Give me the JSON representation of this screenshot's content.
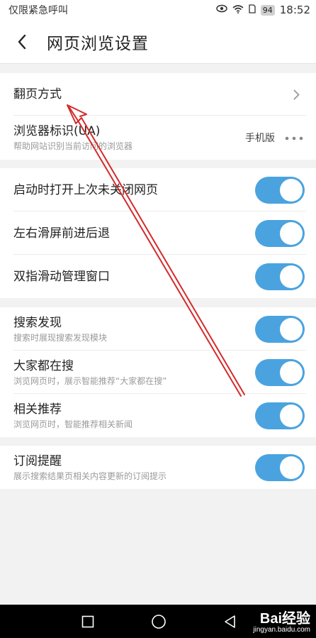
{
  "status_bar": {
    "carrier": "仅限紧急呼叫",
    "battery": "94",
    "time": "18:52"
  },
  "header": {
    "title": "网页浏览设置"
  },
  "group1": [
    {
      "title": "翻页方式",
      "subtitle": "",
      "control": "chevron"
    },
    {
      "title": "浏览器标识(UA)",
      "subtitle": "帮助网站识别当前访问的浏览器",
      "value": "手机版",
      "control": "more"
    }
  ],
  "group2": [
    {
      "title": "启动时打开上次未关闭网页",
      "on": true
    },
    {
      "title": "左右滑屏前进后退",
      "on": true
    },
    {
      "title": "双指滑动管理窗口",
      "on": true
    }
  ],
  "group3": [
    {
      "title": "搜索发现",
      "subtitle": "搜索时展现搜索发现模块",
      "on": true
    },
    {
      "title": "大家都在搜",
      "subtitle": "浏览网页时，展示智能推荐“大家都在搜”",
      "on": true
    },
    {
      "title": "相关推荐",
      "subtitle": "浏览网页时，智能推荐相关新闻",
      "on": true
    }
  ],
  "group4": [
    {
      "title": "订阅提醒",
      "subtitle": "展示搜索结果页相关内容更新的订阅提示",
      "on": true
    }
  ],
  "colors": {
    "toggle_on": "#4aa3df",
    "annotation": "#d42a2a"
  },
  "watermark": {
    "main": "Bai经验",
    "sub": "jingyan.baidu.com"
  }
}
